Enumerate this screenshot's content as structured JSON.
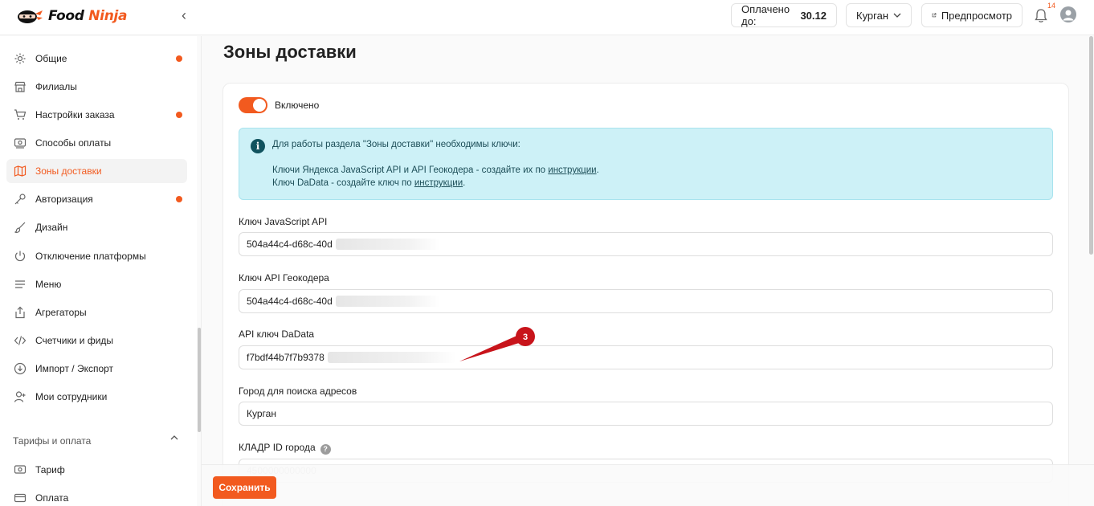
{
  "header": {
    "logo_text_1": "Food",
    "logo_text_2": "Ninja",
    "paid_label": "Оплачено до:",
    "paid_value": "30.12",
    "city": "Курган",
    "preview_label": "Предпросмотр",
    "notifications_count": "14"
  },
  "sidebar": {
    "items": [
      {
        "label": "Общие",
        "icon": "gear-icon",
        "dot": true
      },
      {
        "label": "Филиалы",
        "icon": "store-icon",
        "dot": false
      },
      {
        "label": "Настройки заказа",
        "icon": "cart-icon",
        "dot": true
      },
      {
        "label": "Способы оплаты",
        "icon": "payment-icon",
        "dot": false
      },
      {
        "label": "Зоны доставки",
        "icon": "map-icon",
        "dot": false,
        "active": true
      },
      {
        "label": "Авторизация",
        "icon": "key-icon",
        "dot": true
      },
      {
        "label": "Дизайн",
        "icon": "brush-icon",
        "dot": false
      },
      {
        "label": "Отключение платформы",
        "icon": "power-icon",
        "dot": false
      },
      {
        "label": "Меню",
        "icon": "menu-icon",
        "dot": false
      },
      {
        "label": "Агрегаторы",
        "icon": "upload-icon",
        "dot": false
      },
      {
        "label": "Счетчики и фиды",
        "icon": "code-icon",
        "dot": false
      },
      {
        "label": "Импорт / Экспорт",
        "icon": "download-icon",
        "dot": false
      },
      {
        "label": "Мои сотрудники",
        "icon": "user-add-icon",
        "dot": false
      }
    ],
    "section_title": "Тарифы и оплата",
    "section_items": [
      {
        "label": "Тариф",
        "icon": "tariff-icon"
      },
      {
        "label": "Оплата",
        "icon": "card-icon"
      }
    ]
  },
  "main": {
    "title": "Зоны доставки",
    "toggle_label": "Включено",
    "alert": {
      "line1": "Для работы раздела \"Зоны доставки\" необходимы ключи:",
      "line2_prefix": "Ключи Яндекса JavaScript API и API Геокодера - создайте их по ",
      "line2_link": "инструкции",
      "line2_suffix": ".",
      "line3_prefix": "Ключ DaData - создайте ключ по ",
      "line3_link": "инструкции",
      "line3_suffix": "."
    },
    "fields": {
      "js_api_label": "Ключ JavaScript API",
      "js_api_value": "504a44c4-d68c-40d",
      "geocoder_label": "Ключ API Геокодера",
      "geocoder_value": "504a44c4-d68c-40d",
      "dadata_label": "API ключ DaData",
      "dadata_value": "f7bdf44b7f7b9378",
      "city_label": "Город для поиска адресов",
      "city_value": "Курган",
      "kladr_label": "КЛАДР ID города",
      "kladr_placeholder": "4500000000000"
    },
    "annotation_number": "3",
    "save_label": "Сохранить"
  },
  "colors": {
    "accent": "#f25a1f",
    "alert_bg": "#cdf1f7",
    "annotation": "#c8141b"
  }
}
